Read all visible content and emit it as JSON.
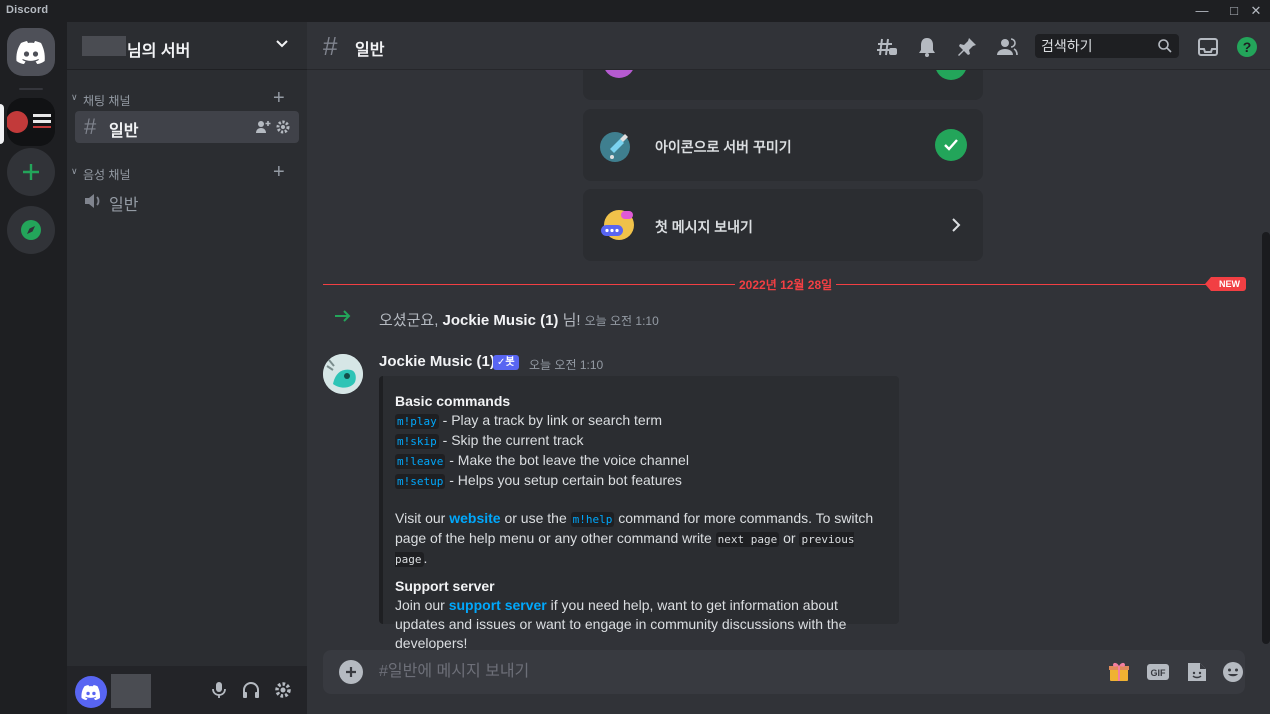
{
  "app": {
    "title": "Discord"
  },
  "server": {
    "name_suffix": "님의 서버"
  },
  "categories": [
    {
      "label": "채팅 채널"
    },
    {
      "label": "음성 채널"
    }
  ],
  "channels": {
    "text": {
      "label": "일반"
    },
    "voice": {
      "label": "일반"
    }
  },
  "topbar": {
    "channel_name": "일반",
    "search_placeholder": "검색하기"
  },
  "setup_cards": [
    {
      "label": "아이콘으로 서버 꾸미기",
      "status": "done"
    },
    {
      "label": "첫 메시지 보내기",
      "status": "next"
    }
  ],
  "divider": {
    "date": "2022년 12월 28일",
    "badge": "NEW"
  },
  "system_message": {
    "prefix": "오셨군요, ",
    "user": "Jockie Music (1)",
    "suffix": " 님!",
    "timestamp": "오늘 오전 1:10"
  },
  "message": {
    "author": "Jockie Music (1)",
    "bot_tag": "✓봇",
    "timestamp": "오늘 오전 1:10",
    "embed": {
      "basic_title": "Basic commands",
      "commands": [
        {
          "cmd": "m!play",
          "desc": " - Play a track by link or search term"
        },
        {
          "cmd": "m!skip",
          "desc": " - Skip the current track"
        },
        {
          "cmd": "m!leave",
          "desc": " - Make the bot leave the voice channel"
        },
        {
          "cmd": "m!setup",
          "desc": " - Helps you setup certain bot features"
        }
      ],
      "visit_1": "Visit our ",
      "website": "website",
      "visit_2": " or use the ",
      "help_cmd": "m!help",
      "visit_3": " command for more commands. To switch page of the help menu or any other command write ",
      "next_page": "next page",
      "or": " or ",
      "previous_page": "previous page",
      "period": ".",
      "support_title": "Support server",
      "support_1": "Join our ",
      "support_link": "support server",
      "support_2": " if you need help, want to get information about updates and issues or want to engage in community discussions with the developers!"
    }
  },
  "composer": {
    "placeholder": "#일반에 메시지 보내기"
  },
  "icons": {
    "titlebar": [
      "minimize-icon",
      "maximize-icon",
      "close-icon"
    ],
    "topbar": [
      "threads-icon",
      "bell-icon",
      "pin-icon",
      "members-icon",
      "search-icon",
      "inbox-icon",
      "help-icon"
    ],
    "composer": [
      "gift-icon",
      "gif-icon",
      "sticker-icon",
      "emoji-icon"
    ],
    "userbar": [
      "microphone-icon",
      "headphones-icon",
      "settings-icon"
    ]
  },
  "colors": {
    "accent": "#5865f2",
    "success": "#23a55a",
    "danger": "#f23f43",
    "link": "#00a8fc"
  }
}
